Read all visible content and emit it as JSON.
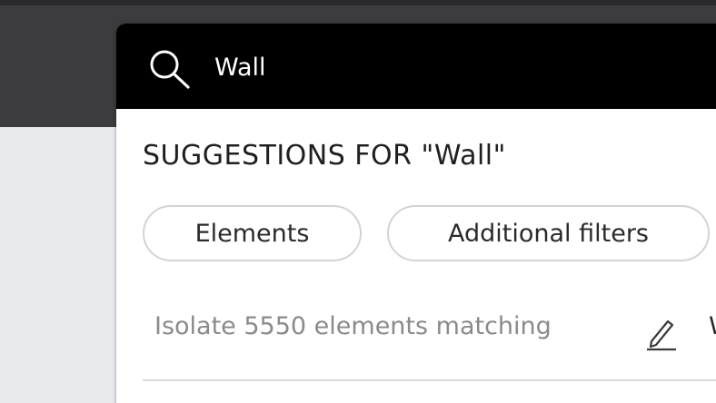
{
  "search": {
    "query": "Wall",
    "icon": "search-icon"
  },
  "suggestions": {
    "title": "SUGGESTIONS FOR \"Wall\"",
    "chips": [
      {
        "label": "Elements"
      },
      {
        "label": "Additional filters"
      }
    ],
    "isolate_text": "Isolate 5550 elements matching",
    "edit_icon": "pencil-icon",
    "truncated_text": "W"
  },
  "colors": {
    "search_bar_bg": "#000000",
    "panel_bg": "#ffffff",
    "app_topbar": "#3c3c3e",
    "chip_border": "#d3d3d3",
    "muted_text": "#8a8a8a"
  }
}
